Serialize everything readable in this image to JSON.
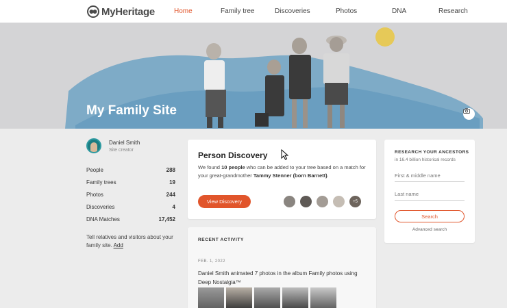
{
  "nav": {
    "brand": "MyHeritage",
    "items": [
      {
        "label": "Home",
        "active": true
      },
      {
        "label": "Family tree",
        "active": false
      },
      {
        "label": "Discoveries",
        "active": false
      },
      {
        "label": "Photos",
        "active": false
      },
      {
        "label": "DNA",
        "active": false
      },
      {
        "label": "Research",
        "active": false
      }
    ]
  },
  "hero": {
    "title": "My Family Site",
    "camera_icon": "camera-icon"
  },
  "user": {
    "name": "Daniel Smith",
    "role": "Site creator"
  },
  "stats": [
    {
      "label": "People",
      "value": "288"
    },
    {
      "label": "Family trees",
      "value": "19"
    },
    {
      "label": "Photos",
      "value": "244"
    },
    {
      "label": "Discoveries",
      "value": "4"
    },
    {
      "label": "DNA Matches",
      "value": "17,452"
    }
  ],
  "invite": {
    "text": "Tell relatives and visitors about your family site.",
    "link": "Add"
  },
  "person_discovery": {
    "title": "Person Discovery",
    "text_prefix": "We found ",
    "count": "10 people",
    "text_middle": " who can be added to your tree based on a match for your great-grandmother ",
    "person": "Tammy Stenner (born Barnett)",
    "text_suffix": ".",
    "button": "View Discovery",
    "more_badge": "+5"
  },
  "recent_activity": {
    "title": "RECENT ACTIVITY",
    "date": "FEB. 1, 2022",
    "actor": "Daniel Smith",
    "text_middle": " animated 7 photos in the album ",
    "album": "Family photos",
    "text_suffix": " using Deep Nostalgia™"
  },
  "research": {
    "title": "RESEARCH YOUR ANCESTORS",
    "subtitle": "in 16.4 billion historical records",
    "first_placeholder": "First & middle name",
    "last_placeholder": "Last name",
    "search": "Search",
    "advanced": "Advanced search"
  },
  "colors": {
    "accent": "#e1552b",
    "hero_bg": "#d4d4d6",
    "watercolor": "#6fa3c4"
  }
}
